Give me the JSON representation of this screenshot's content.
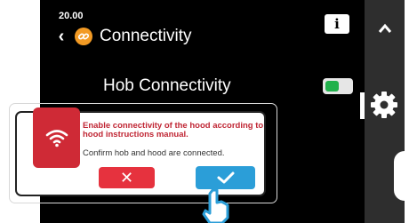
{
  "status": {
    "time": "20.00"
  },
  "header": {
    "title": "Connectivity",
    "back_icon": "chevron-left-icon",
    "section_icon": "link-icon"
  },
  "info": {
    "label": "i"
  },
  "setting": {
    "label": "Hob Connectivity",
    "toggle_on": true
  },
  "colors": {
    "accent_orange": "#f29a24",
    "toggle_green": "#22b14c",
    "cancel_red": "#e6323e",
    "confirm_blue": "#2b9ed8",
    "badge_red": "#cf2a36"
  },
  "dialog": {
    "message_primary": "Enable connectivity of the hood according to hood instructions manual.",
    "message_secondary": "Confirm hob and hood are connected.",
    "cancel_symbol": "✕",
    "badge_icon": "wifi-icon",
    "confirm_icon": "check-icon"
  },
  "rail": {
    "up_symbol": "⌃",
    "settings_icon": "gear-icon"
  }
}
